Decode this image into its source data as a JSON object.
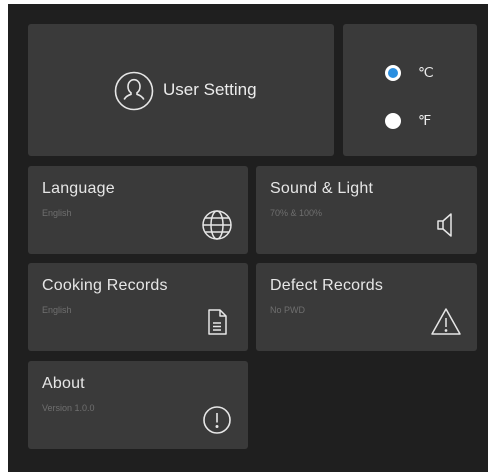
{
  "user_setting": {
    "label": "User Setting",
    "icon": "user-icon"
  },
  "temperature": {
    "options": [
      {
        "label": "℃",
        "selected": true
      },
      {
        "label": "℉",
        "selected": false
      }
    ],
    "selected_color": "#2b8fe0"
  },
  "tiles": {
    "language": {
      "title": "Language",
      "subtitle": "English",
      "icon": "globe-icon"
    },
    "sound_light": {
      "title": "Sound & Light",
      "subtitle": "70% & 100%",
      "icon": "speaker-icon"
    },
    "cooking_records": {
      "title": "Cooking Records",
      "subtitle": "English",
      "icon": "document-icon"
    },
    "defect_records": {
      "title": "Defect Records",
      "subtitle": "No PWD",
      "icon": "warning-icon"
    },
    "about": {
      "title": "About",
      "subtitle": "Version 1.0.0",
      "icon": "info-icon"
    }
  }
}
